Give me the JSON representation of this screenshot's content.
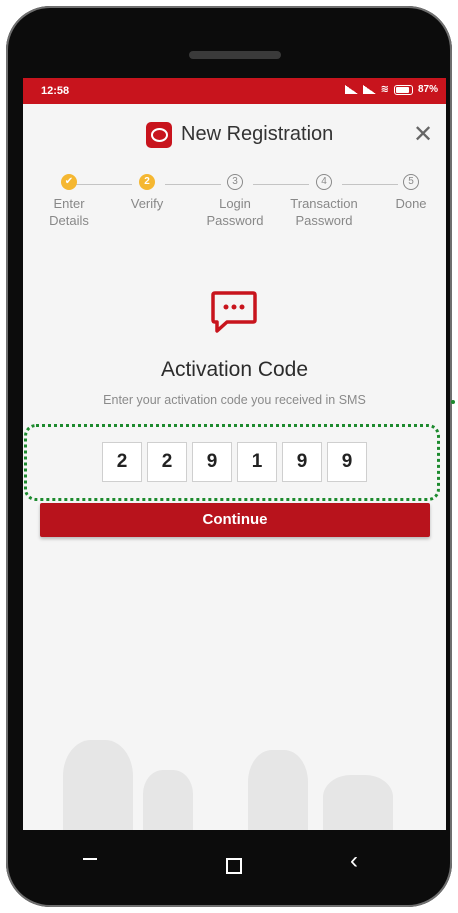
{
  "status_bar": {
    "time": "12:58",
    "battery": "87%"
  },
  "header": {
    "title": "New Registration",
    "close_symbol": "✕"
  },
  "steps": [
    {
      "number": "✔",
      "line1": "Enter",
      "line2": "Details",
      "state": "done"
    },
    {
      "number": "2",
      "line1": "Verify",
      "line2": "",
      "state": "active"
    },
    {
      "number": "3",
      "line1": "Login",
      "line2": "Password",
      "state": "todo"
    },
    {
      "number": "4",
      "line1": "Transaction",
      "line2": "Password",
      "state": "todo"
    },
    {
      "number": "5",
      "line1": "Done",
      "line2": "",
      "state": "todo"
    }
  ],
  "main": {
    "heading": "Activation Code",
    "subtext": "Enter your activation code you received in SMS",
    "code_digits": [
      "2",
      "2",
      "9",
      "1",
      "9",
      "9"
    ],
    "continue_label": "Continue"
  },
  "colors": {
    "brand_red": "#c8141d",
    "step_yellow": "#f5b731",
    "highlight_green": "#1d8a2e"
  },
  "icons": [
    "sms-icon",
    "close-icon",
    "signal-icon",
    "wifi-icon",
    "battery-icon"
  ]
}
